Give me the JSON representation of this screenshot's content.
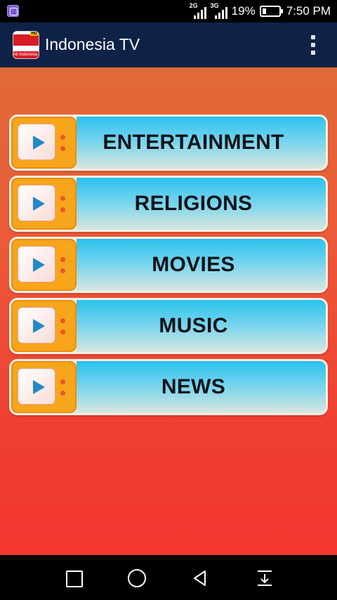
{
  "status_bar": {
    "network_1": "2G",
    "network_2": "3G",
    "battery_percent": "19%",
    "battery_level": 0.19,
    "time": "7:50 PM",
    "notification_icon": "gallery-notification-icon"
  },
  "app_bar": {
    "title": "Indonesia TV",
    "logo_text": "All Indonesia TV",
    "logo_badge": "HD",
    "menu_icon": "overflow-menu-icon"
  },
  "categories": [
    {
      "label": "ENTERTAINMENT",
      "icon": "tv-play-icon"
    },
    {
      "label": "RELIGIONS",
      "icon": "tv-play-icon"
    },
    {
      "label": "MOVIES",
      "icon": "tv-play-icon"
    },
    {
      "label": "MUSIC",
      "icon": "tv-play-icon"
    },
    {
      "label": "NEWS",
      "icon": "tv-play-icon"
    }
  ],
  "colors": {
    "app_bar": "#0e2247",
    "background_top": "#e06a38",
    "background_bottom": "#f2362f",
    "tv_icon": "#f7a51b",
    "play_icon": "#2289c9",
    "button_gradient_top": "#2ac2ee",
    "button_gradient_bottom": "#d9e6df"
  },
  "nav_bar": {
    "recents_icon": "square-recents-icon",
    "home_icon": "circle-home-icon",
    "back_icon": "triangle-back-icon",
    "pulldown_icon": "notification-pulldown-icon"
  }
}
